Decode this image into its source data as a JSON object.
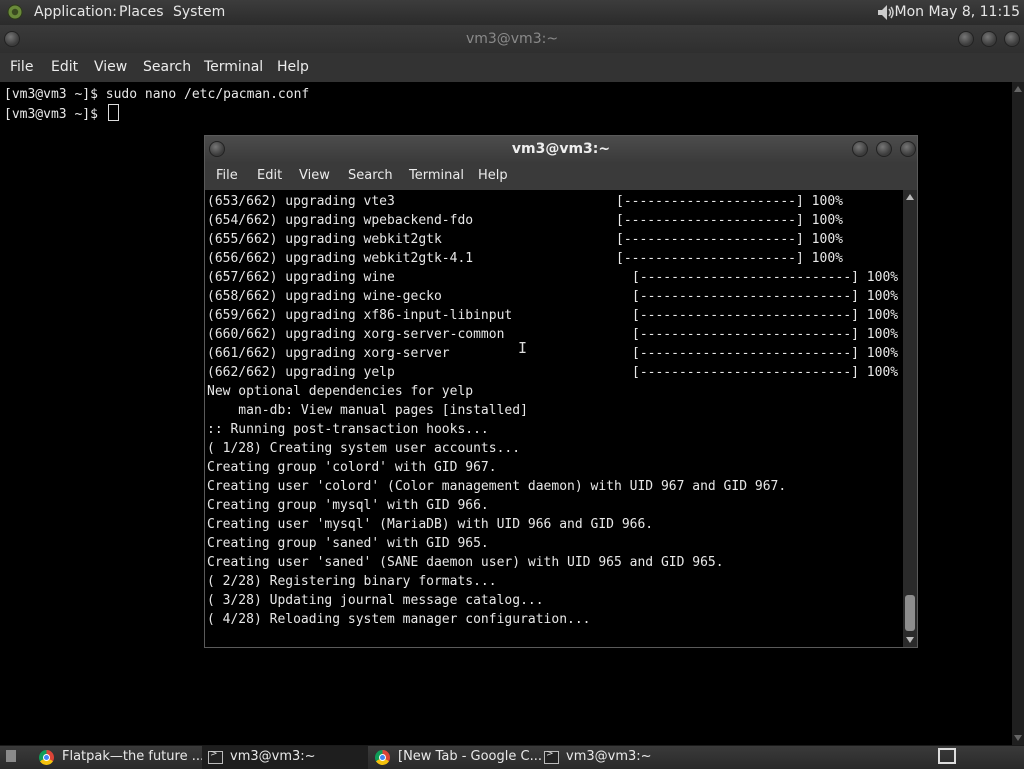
{
  "top_panel": {
    "menus": [
      "Application:",
      "Places",
      "System"
    ],
    "clock": "Mon May  8, 11:15",
    "icons": [
      "gnome-foot-icon",
      "volume-icon"
    ]
  },
  "outer_window": {
    "title": "vm3@vm3:~",
    "menus": [
      "File",
      "Edit",
      "View",
      "Search",
      "Terminal",
      "Help"
    ],
    "lines": [
      "[vm3@vm3 ~]$ sudo nano /etc/pacman.conf",
      "[vm3@vm3 ~]$ "
    ]
  },
  "inner_window": {
    "title": "vm3@vm3:~",
    "menus": [
      "File",
      "Edit",
      "View",
      "Search",
      "Terminal",
      "Help"
    ],
    "progress_rows": [
      {
        "text": "(653/662) upgrading vte3",
        "bar": "[----------------------] 100%",
        "percent": 100
      },
      {
        "text": "(654/662) upgrading wpebackend-fdo",
        "bar": "[----------------------] 100%",
        "percent": 100
      },
      {
        "text": "(655/662) upgrading webkit2gtk",
        "bar": "[----------------------] 100%",
        "percent": 100
      },
      {
        "text": "(656/662) upgrading webkit2gtk-4.1",
        "bar": "[----------------------] 100%",
        "percent": 100
      },
      {
        "text": "(657/662) upgrading wine",
        "bar": "[---------------------------] 100%",
        "percent": 100
      },
      {
        "text": "(658/662) upgrading wine-gecko",
        "bar": "[---------------------------] 100%",
        "percent": 100
      },
      {
        "text": "(659/662) upgrading xf86-input-libinput",
        "bar": "[---------------------------] 100%",
        "percent": 100
      },
      {
        "text": "(660/662) upgrading xorg-server-common",
        "bar": "[---------------------------] 100%",
        "percent": 100
      },
      {
        "text": "(661/662) upgrading xorg-server",
        "bar": "[---------------------------] 100%",
        "percent": 100
      },
      {
        "text": "(662/662) upgrading yelp",
        "bar": "[---------------------------] 100%",
        "percent": 100
      }
    ],
    "text_lines": [
      "New optional dependencies for yelp",
      "    man-db: View manual pages [installed]",
      ":: Running post-transaction hooks...",
      "( 1/28) Creating system user accounts...",
      "Creating group 'colord' with GID 967.",
      "Creating user 'colord' (Color management daemon) with UID 967 and GID 967.",
      "Creating group 'mysql' with GID 966.",
      "Creating user 'mysql' (MariaDB) with UID 966 and GID 966.",
      "Creating group 'saned' with GID 965.",
      "Creating user 'saned' (SANE daemon user) with UID 965 and GID 965.",
      "( 2/28) Registering binary formats...",
      "( 3/28) Updating journal message catalog...",
      "( 4/28) Reloading system manager configuration..."
    ]
  },
  "taskbar": {
    "tasks": [
      {
        "label": "Flatpak—the future ...",
        "icon": "chrome-icon",
        "active": false
      },
      {
        "label": "vm3@vm3:~",
        "icon": "terminal-icon",
        "active": true
      },
      {
        "label": "[New Tab - Google C...",
        "icon": "chrome-icon",
        "active": false
      },
      {
        "label": "vm3@vm3:~",
        "icon": "terminal-icon",
        "active": false
      }
    ]
  }
}
